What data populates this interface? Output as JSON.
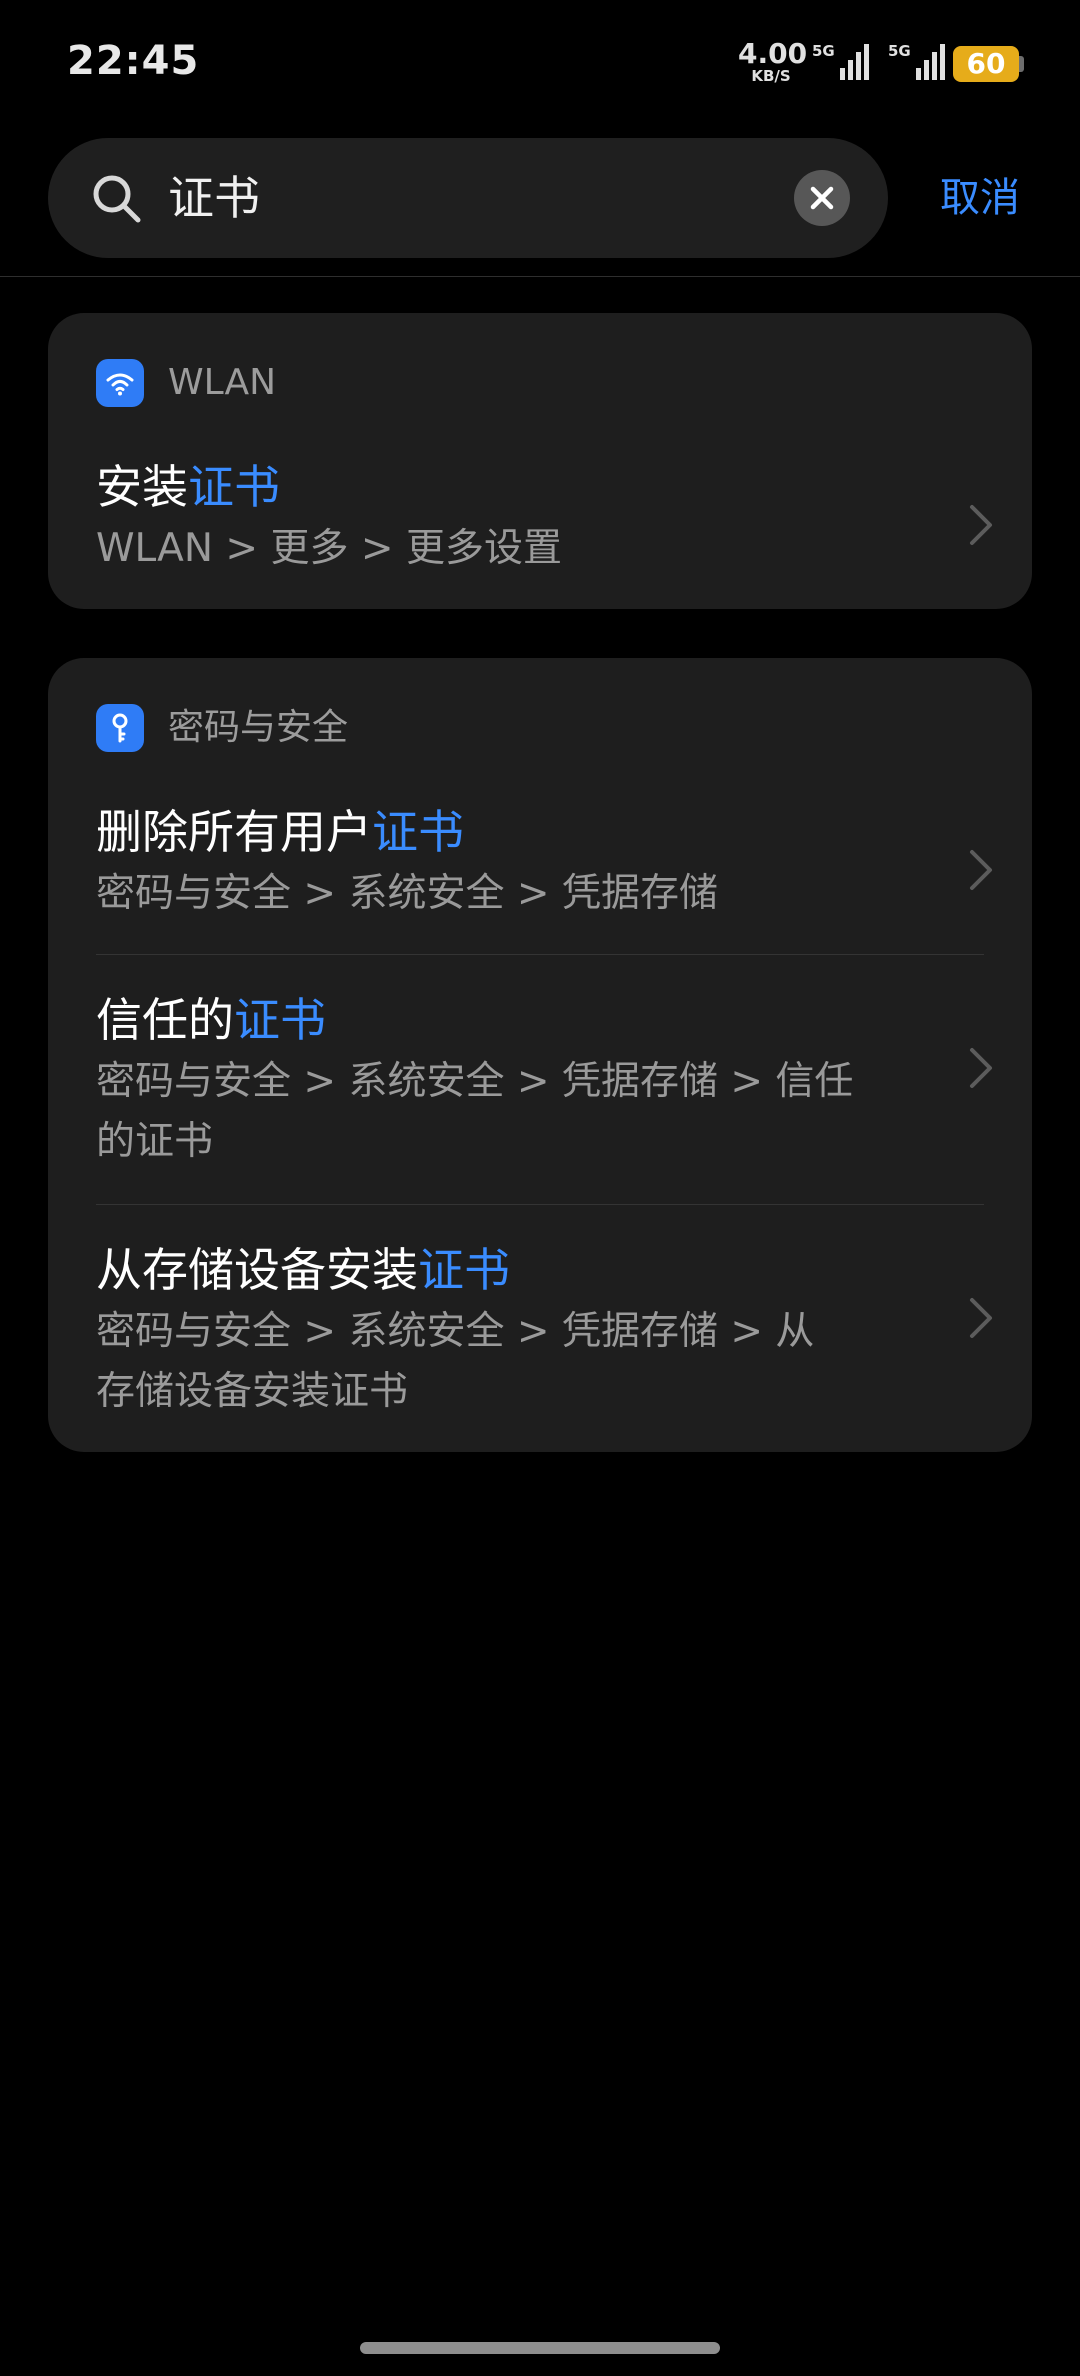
{
  "status": {
    "time": "22:45",
    "speed_value": "4.00",
    "speed_unit": "KB/S",
    "sim1": "5G",
    "sim2": "5G",
    "battery": "60"
  },
  "search": {
    "query": "证书",
    "cancel_label": "取消"
  },
  "groups": [
    {
      "app": "WLAN",
      "icon": "wifi-icon",
      "items": [
        {
          "title_plain": "安装",
          "title_match": "证书",
          "path": "WLAN > 更多 > 更多设置"
        }
      ]
    },
    {
      "app": "密码与安全",
      "icon": "key-icon",
      "items": [
        {
          "title_plain": "删除所有用户",
          "title_match": "证书",
          "path": "密码与安全 > 系统安全 > 凭据存储"
        },
        {
          "title_plain": "信任的",
          "title_match": "证书",
          "path": "密码与安全 > 系统安全 > 凭据存储 > 信任的证书"
        },
        {
          "title_plain": "从存储设备安装",
          "title_match": "证书",
          "path": "密码与安全 > 系统安全 > 凭据存储 > 从存储设备安装证书"
        }
      ]
    }
  ],
  "colors": {
    "accent": "#3a8cff",
    "card_bg": "#1e1e1e",
    "battery": "#e6ac1a"
  }
}
